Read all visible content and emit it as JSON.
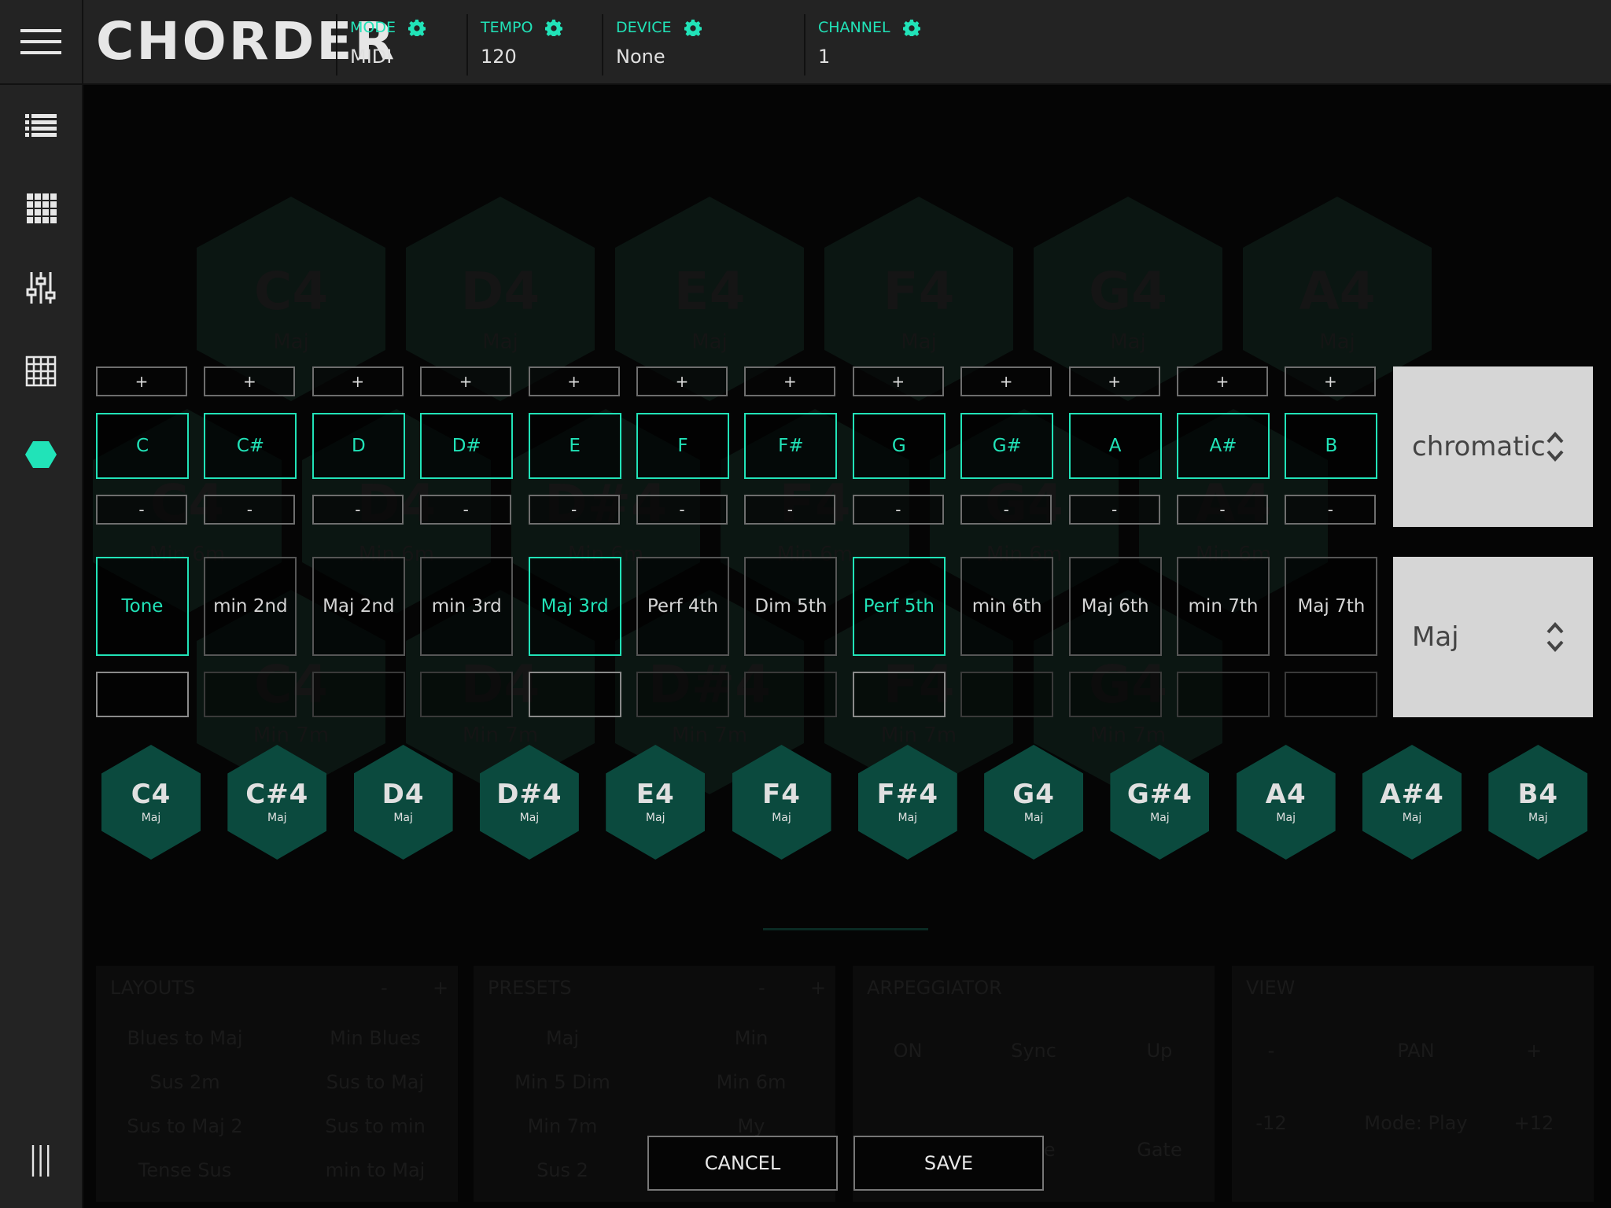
{
  "app": {
    "title": "CHORDER"
  },
  "header": {
    "mode": {
      "label": "MODE",
      "value": "MIDI"
    },
    "tempo": {
      "label": "TEMPO",
      "value": "120"
    },
    "device": {
      "label": "DEVICE",
      "value": "None"
    },
    "channel": {
      "label": "CHANNEL",
      "value": "1"
    }
  },
  "sidebar": {
    "icons": [
      "list-icon",
      "grid-icon",
      "sliders-icon",
      "table-icon",
      "hexagon-icon",
      "columns-icon"
    ],
    "active_index": 4
  },
  "editor": {
    "plus_label": "+",
    "minus_label": "-",
    "notes": [
      "C",
      "C#",
      "D",
      "D#",
      "E",
      "F",
      "F#",
      "G",
      "G#",
      "A",
      "A#",
      "B"
    ],
    "intervals": [
      {
        "label": "Tone",
        "on": true
      },
      {
        "label": "min 2nd",
        "on": false
      },
      {
        "label": "Maj 2nd",
        "on": false
      },
      {
        "label": "min 3rd",
        "on": false
      },
      {
        "label": "Maj 3rd",
        "on": true
      },
      {
        "label": "Perf 4th",
        "on": false
      },
      {
        "label": "Dim 5th",
        "on": false
      },
      {
        "label": "Perf 5th",
        "on": true
      },
      {
        "label": "min 6th",
        "on": false
      },
      {
        "label": "Maj 6th",
        "on": false
      },
      {
        "label": "min 7th",
        "on": false
      },
      {
        "label": "Maj 7th",
        "on": false
      }
    ],
    "scale_select": "chromatic",
    "chord_select": "Maj"
  },
  "chords": [
    {
      "name": "C4",
      "quality": "Maj"
    },
    {
      "name": "C#4",
      "quality": "Maj"
    },
    {
      "name": "D4",
      "quality": "Maj"
    },
    {
      "name": "D#4",
      "quality": "Maj"
    },
    {
      "name": "E4",
      "quality": "Maj"
    },
    {
      "name": "F4",
      "quality": "Maj"
    },
    {
      "name": "F#4",
      "quality": "Maj"
    },
    {
      "name": "G4",
      "quality": "Maj"
    },
    {
      "name": "G#4",
      "quality": "Maj"
    },
    {
      "name": "A4",
      "quality": "Maj"
    },
    {
      "name": "A#4",
      "quality": "Maj"
    },
    {
      "name": "B4",
      "quality": "Maj"
    }
  ],
  "background": {
    "hex_row1": [
      {
        "name": "C4",
        "q": "Maj"
      },
      {
        "name": "D4",
        "q": "Maj"
      },
      {
        "name": "E4",
        "q": "Maj"
      },
      {
        "name": "F4",
        "q": "Maj"
      },
      {
        "name": "G4",
        "q": "Maj"
      },
      {
        "name": "A4",
        "q": "Maj"
      }
    ],
    "hex_row2": [
      {
        "name": "C4",
        "q": "Min 6m"
      },
      {
        "name": "D4",
        "q": "Min 6m"
      },
      {
        "name": "D#4",
        "q": "Min 6m"
      },
      {
        "name": "F4",
        "q": "Min 6m"
      },
      {
        "name": "G4",
        "q": "Min 6m"
      },
      {
        "name": "A4",
        "q": "Min 6m"
      }
    ],
    "hex_row3": [
      {
        "name": "C4",
        "q": "Min 7m"
      },
      {
        "name": "D4",
        "q": "Min 7m"
      },
      {
        "name": "D#4",
        "q": "Min 7m"
      },
      {
        "name": "F4",
        "q": "Min 7m"
      },
      {
        "name": "G4",
        "q": "Min 7m"
      }
    ],
    "layouts": {
      "title": "LAYOUTS",
      "minus": "-",
      "plus": "+",
      "items": [
        "Blues to Maj",
        "Min Blues",
        "Sus 2m",
        "Sus to Maj",
        "Sus to Maj 2",
        "Sus to min",
        "Tense Sus",
        "min to Maj"
      ]
    },
    "presets": {
      "title": "PRESETS",
      "minus": "-",
      "plus": "+",
      "items": [
        "Maj",
        "Min",
        "Min 5 Dim",
        "Min 6m",
        "Min 7m",
        "My",
        "Sus 2",
        ""
      ]
    },
    "arpeggiator": {
      "title": "ARPEGGIATOR",
      "buttons": [
        "ON",
        "Sync",
        "Up"
      ],
      "knobs": [
        "Steps",
        "Rate",
        "Gate"
      ]
    },
    "view": {
      "title": "VIEW",
      "buttons": [
        "-",
        "PAN",
        "+",
        "-12",
        "Mode: Play",
        "+12"
      ]
    }
  },
  "dialog": {
    "cancel": "CANCEL",
    "save": "SAVE"
  },
  "colors": {
    "accent": "#21e3b8",
    "hex_fill": "#0b4a3e",
    "bar": "#232323"
  }
}
